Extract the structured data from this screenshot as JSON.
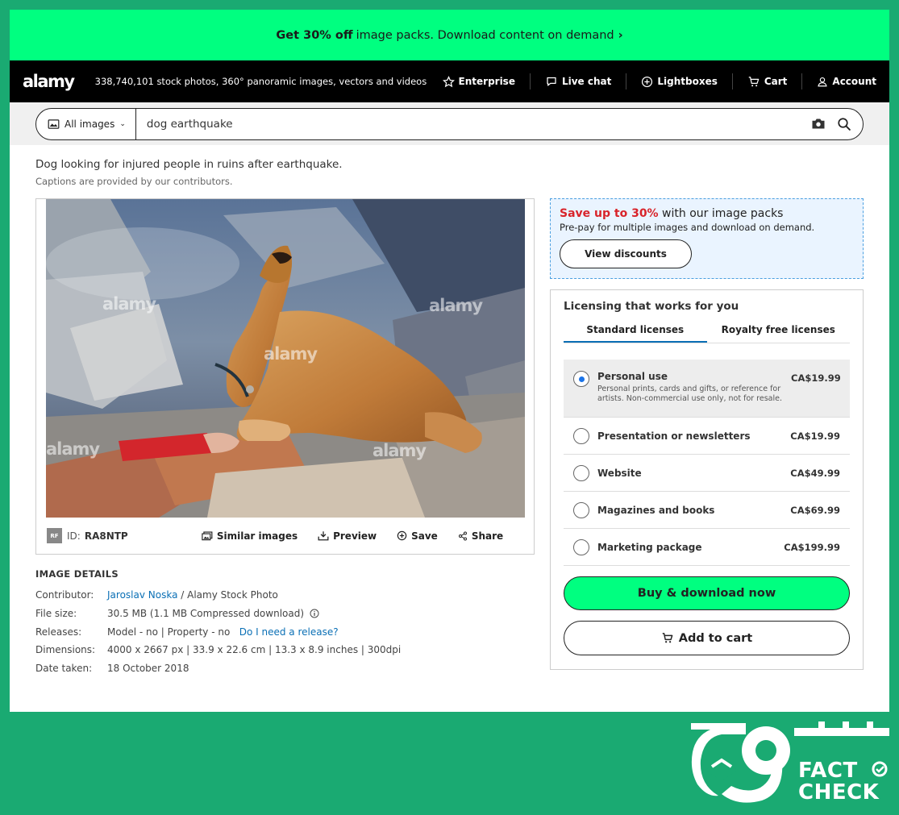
{
  "promo": {
    "bold": "Get 30% off",
    "text": "image packs. Download content on demand"
  },
  "header": {
    "logo": "alamy",
    "tagline": "338,740,101 stock photos, 360° panoramic images, vectors and videos",
    "nav": [
      "Enterprise",
      "Live chat",
      "Lightboxes",
      "Cart",
      "Account"
    ]
  },
  "search": {
    "category": "All images",
    "query": "dog earthquake"
  },
  "image": {
    "caption": "Dog looking for injured people in ruins after earthquake.",
    "caption_note": "Captions are provided by our contributors.",
    "license_badge": "RF",
    "id_label": "ID:",
    "id_value": "RA8NTP",
    "watermark": "alamy",
    "actions": [
      "Similar images",
      "Preview",
      "Save",
      "Share"
    ]
  },
  "details": {
    "heading": "IMAGE DETAILS",
    "contributor_label": "Contributor:",
    "contributor_name": "Jaroslav Noska",
    "contributor_agency": "/ Alamy Stock Photo",
    "filesize_label": "File size:",
    "filesize_value": "30.5 MB (1.1 MB Compressed download)",
    "releases_label": "Releases:",
    "releases_value": "Model - no | Property - no",
    "releases_link": "Do I need a release?",
    "dimensions_label": "Dimensions:",
    "dimensions_value": "4000 x 2667 px | 33.9 x 22.6 cm | 13.3 x 8.9 inches | 300dpi",
    "date_label": "Date taken:",
    "date_value": "18 October 2018"
  },
  "discount": {
    "highlight": "Save up to 30%",
    "title_rest": "with our image packs",
    "subtitle": "Pre-pay for multiple images and download on demand.",
    "button": "View discounts"
  },
  "licensing": {
    "title": "Licensing that works for you",
    "tabs": [
      "Standard licenses",
      "Royalty free licenses"
    ],
    "options": [
      {
        "label": "Personal use",
        "price": "CA$19.99",
        "desc": "Personal prints, cards and gifts, or reference for artists. Non-commercial use only, not for resale.",
        "selected": true
      },
      {
        "label": "Presentation or newsletters",
        "price": "CA$19.99"
      },
      {
        "label": "Website",
        "price": "CA$49.99"
      },
      {
        "label": "Magazines and books",
        "price": "CA$69.99"
      },
      {
        "label": "Marketing package",
        "price": "CA$199.99"
      }
    ],
    "buy_button": "Buy & download now",
    "cart_button": "Add to cart"
  },
  "factcheck": {
    "line1": "FACT",
    "line2": "CHECK"
  },
  "colors": {
    "accent_green": "#00ff80",
    "background_green": "#1aaa72",
    "link_blue": "#0a6fb5",
    "highlight_red": "#d8232a"
  }
}
